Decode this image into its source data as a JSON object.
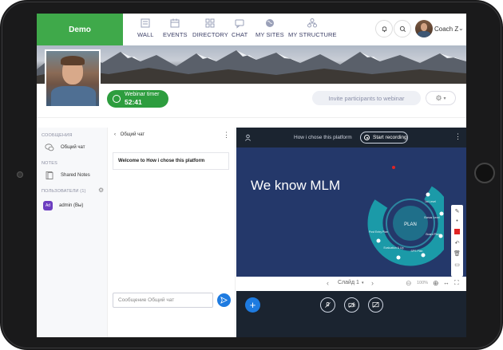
{
  "app": {
    "logo": "Demo"
  },
  "nav": [
    {
      "label": "WALL",
      "icon": "wall-icon"
    },
    {
      "label": "EVENTS",
      "icon": "calendar-icon"
    },
    {
      "label": "DIRECTORY",
      "icon": "grid-icon"
    },
    {
      "label": "CHAT",
      "icon": "chat-icon"
    },
    {
      "label": "MY SITES",
      "icon": "globe-icon"
    },
    {
      "label": "MY STRUCTURE",
      "icon": "structure-icon"
    }
  ],
  "user": {
    "name": "Coach Z"
  },
  "webinar": {
    "timer_label": "Webinar timer",
    "timer_value": "52:41",
    "invite_label": "Invite participants to webinar"
  },
  "sidebar": {
    "messages_header": "СООБЩЕНИЯ",
    "general_chat": "Общий чат",
    "notes_header": "NOTES",
    "shared_notes": "Shared Notes",
    "users_header": "ПОЛЬЗОВАТЕЛИ (1)",
    "admin_initials": "Ad",
    "admin_name": "admin (Вы)"
  },
  "chat": {
    "title": "Общий чат",
    "welcome": "Welcome to How i chose this platform",
    "placeholder": "Сообщение Общий чат"
  },
  "presentation": {
    "title": "How i chose this platform",
    "record_label": "Start recording",
    "slide_heading": "We know MLM",
    "plan_center": "PLAN",
    "plan_segments": [
      "1st Level",
      "Bonus Level",
      "Board Plan",
      "SPS Plan",
      "Evaluation & Up",
      "Post Entry Plan"
    ],
    "slide_label": "Слайд 1",
    "zoom": "100%",
    "colors": {
      "accent": "#1e7be0",
      "slide_bg": "#24386a",
      "plan_teal": "#1b9aa8"
    }
  }
}
